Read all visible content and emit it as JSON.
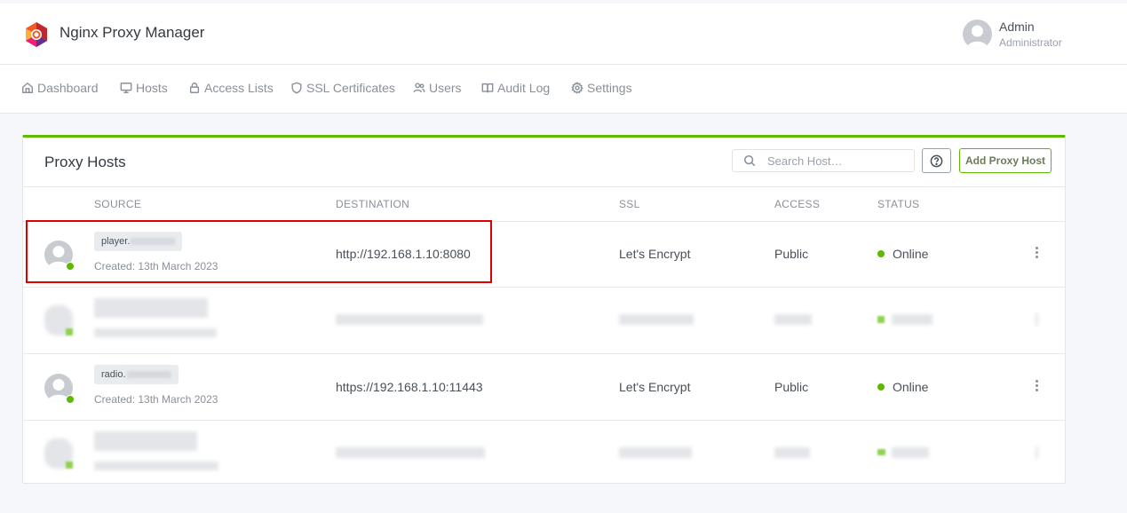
{
  "app": {
    "title": "Nginx Proxy Manager",
    "user_name": "Admin",
    "user_role": "Administrator"
  },
  "nav": [
    {
      "label": "Dashboard",
      "icon": "home-icon"
    },
    {
      "label": "Hosts",
      "icon": "monitor-icon"
    },
    {
      "label": "Access Lists",
      "icon": "lock-icon"
    },
    {
      "label": "SSL Certificates",
      "icon": "shield-icon"
    },
    {
      "label": "Users",
      "icon": "users-icon"
    },
    {
      "label": "Audit Log",
      "icon": "book-icon"
    },
    {
      "label": "Settings",
      "icon": "gear-icon"
    }
  ],
  "card": {
    "title": "Proxy Hosts",
    "search_placeholder": "Search Host…",
    "add_button": "Add Proxy Host",
    "accent_color": "#5eba00"
  },
  "table": {
    "columns": [
      "SOURCE",
      "DESTINATION",
      "SSL",
      "ACCESS",
      "STATUS"
    ],
    "rows": [
      {
        "domain": "player.",
        "created": "Created: 13th March 2023",
        "destination": "http://192.168.1.10:8080",
        "ssl": "Let's Encrypt",
        "access": "Public",
        "status": "Online",
        "blurred": false
      },
      {
        "domain": "",
        "created": "",
        "destination": "",
        "ssl": "",
        "access": "",
        "status": "",
        "blurred": true
      },
      {
        "domain": "radio.",
        "created": "Created: 13th March 2023",
        "destination": "https://192.168.1.10:11443",
        "ssl": "Let's Encrypt",
        "access": "Public",
        "status": "Online",
        "blurred": false
      },
      {
        "domain": "",
        "created": "",
        "destination": "",
        "ssl": "",
        "access": "",
        "status": "",
        "blurred": true
      }
    ]
  },
  "status_color": "#5eba00",
  "highlight_color": "#e00000"
}
